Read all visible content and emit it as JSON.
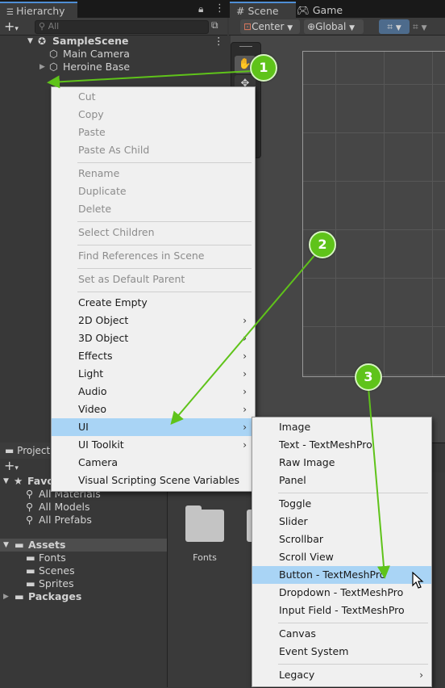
{
  "hierarchy": {
    "tab_title": "Hierarchy",
    "search_placeholder": "All",
    "scene_name": "SampleScene",
    "items": [
      "Main Camera",
      "Heroine Base"
    ]
  },
  "scene": {
    "tabs": [
      "Scene",
      "Game"
    ],
    "pivot_mode": "Center",
    "space_mode": "Global"
  },
  "project": {
    "tab_title": "Project",
    "favorites_label": "Favorites",
    "favorites": [
      "All Materials",
      "All Models",
      "All Prefabs"
    ],
    "assets_label": "Assets",
    "asset_folders": [
      "Fonts",
      "Scenes",
      "Sprites"
    ],
    "packages_label": "Packages",
    "grid_items": [
      "Fonts"
    ]
  },
  "context_menu": {
    "items": [
      {
        "label": "Cut",
        "disabled": true
      },
      {
        "label": "Copy",
        "disabled": true
      },
      {
        "label": "Paste",
        "disabled": true
      },
      {
        "label": "Paste As Child",
        "disabled": true
      },
      {
        "label": "Rename",
        "disabled": true
      },
      {
        "label": "Duplicate",
        "disabled": true
      },
      {
        "label": "Delete",
        "disabled": true
      },
      {
        "label": "Select Children",
        "disabled": true
      },
      {
        "label": "Find References in Scene",
        "disabled": true
      },
      {
        "label": "Set as Default Parent",
        "disabled": true
      },
      {
        "label": "Create Empty"
      },
      {
        "label": "2D Object",
        "submenu": true
      },
      {
        "label": "3D Object",
        "submenu": true
      },
      {
        "label": "Effects",
        "submenu": true
      },
      {
        "label": "Light",
        "submenu": true
      },
      {
        "label": "Audio",
        "submenu": true
      },
      {
        "label": "Video",
        "submenu": true
      },
      {
        "label": "UI",
        "submenu": true,
        "highlighted": true
      },
      {
        "label": "UI Toolkit",
        "submenu": true
      },
      {
        "label": "Camera"
      },
      {
        "label": "Visual Scripting Scene Variables"
      }
    ]
  },
  "ui_submenu": {
    "items": [
      {
        "label": "Image"
      },
      {
        "label": "Text - TextMeshPro"
      },
      {
        "label": "Raw Image"
      },
      {
        "label": "Panel"
      },
      {
        "label": "Toggle"
      },
      {
        "label": "Slider"
      },
      {
        "label": "Scrollbar"
      },
      {
        "label": "Scroll View"
      },
      {
        "label": "Button - TextMeshPro",
        "highlighted": true
      },
      {
        "label": "Dropdown - TextMeshPro"
      },
      {
        "label": "Input Field - TextMeshPro"
      },
      {
        "label": "Canvas"
      },
      {
        "label": "Event System"
      },
      {
        "label": "Legacy",
        "submenu": true
      }
    ]
  },
  "annotations": {
    "steps": [
      "1",
      "2",
      "3"
    ],
    "color": "#5fc31a"
  }
}
